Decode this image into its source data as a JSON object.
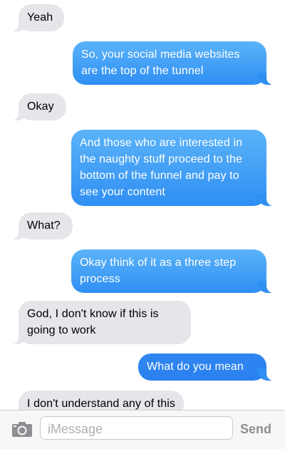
{
  "messages": [
    {
      "sender": "them",
      "text": "Yeah"
    },
    {
      "sender": "me",
      "text": "So, your social media websites are the top of the tunnel"
    },
    {
      "sender": "them",
      "text": "Okay"
    },
    {
      "sender": "me",
      "text": "And those who are interested in the naughty stuff proceed to the bottom of the funnel and pay to see your content"
    },
    {
      "sender": "them",
      "text": "What?"
    },
    {
      "sender": "me",
      "text": "Okay think of it as a three step process"
    },
    {
      "sender": "them",
      "text": "God, I don't know if this is going to work"
    },
    {
      "sender": "me",
      "text": "What do you mean"
    },
    {
      "sender": "them",
      "text": "I don't understand any of this"
    }
  ],
  "composer": {
    "placeholder": "iMessage",
    "send_label": "Send",
    "camera_icon": "camera-icon"
  },
  "colors": {
    "sent_bubble": "#3a95f4",
    "received_bubble": "#e5e5ea",
    "send_button": "#8e8e93"
  }
}
